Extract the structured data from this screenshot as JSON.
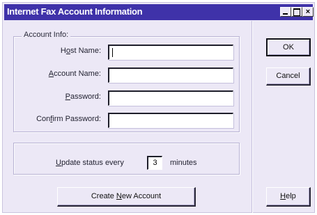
{
  "window": {
    "title": "Internet Fax Account Information",
    "controls": {
      "minimize": "minimize",
      "maximize": "maximize",
      "close": "×"
    },
    "title_color": "#3f32a9",
    "face_color": "#ece8f6"
  },
  "account_group": {
    "legend": "Account Info:",
    "fields": [
      {
        "label_pre": "H",
        "label_accel": "o",
        "label_post": "st Name:",
        "value": ""
      },
      {
        "label_pre": "",
        "label_accel": "A",
        "label_post": "ccount Name:",
        "value": ""
      },
      {
        "label_pre": "",
        "label_accel": "P",
        "label_post": "assword:",
        "value": ""
      },
      {
        "label_pre": "Con",
        "label_accel": "f",
        "label_post": "irm Password:",
        "value": ""
      }
    ]
  },
  "status": {
    "label_pre": "",
    "label_accel": "U",
    "label_post": "pdate status every",
    "value": "3",
    "unit": "minutes"
  },
  "buttons": {
    "ok": {
      "pre": "",
      "accel": "",
      "post": "OK"
    },
    "cancel": {
      "pre": "",
      "accel": "",
      "post": "Cancel"
    },
    "help": {
      "pre": "",
      "accel": "H",
      "post": "elp"
    },
    "create": {
      "pre": "Create ",
      "accel": "N",
      "post": "ew Account"
    }
  }
}
